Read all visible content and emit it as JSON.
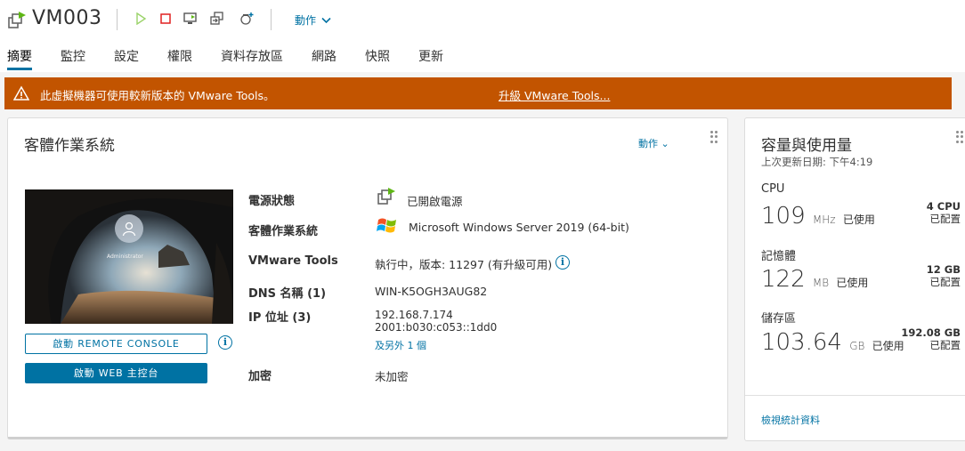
{
  "header": {
    "title": "VM003",
    "actions_label": "動作",
    "icons": [
      "vm-powered-on-icon",
      "power-on-icon",
      "power-off-icon",
      "launch-console-icon",
      "migrate-icon",
      "snapshot-icon"
    ]
  },
  "tabs": [
    "摘要",
    "監控",
    "設定",
    "權限",
    "資料存放區",
    "網路",
    "快照",
    "更新"
  ],
  "active_tab": "摘要",
  "banner": {
    "message": "此虛擬機器可使用較新版本的 VMware Tools。",
    "link": "升級 VMware Tools...",
    "color": "#c25400"
  },
  "guest": {
    "title": "客體作業系統",
    "actions_label": "動作",
    "console_user": "Administrator",
    "remote_console_button": "啟動 REMOTE CONSOLE",
    "web_console_button": "啟動 WEB 主控台",
    "properties": {
      "power_label": "電源狀態",
      "power_value": "已開啟電源",
      "os_label": "客體作業系統",
      "os_value": "Microsoft Windows Server 2019 (64-bit)",
      "tools_label": "VMware Tools",
      "tools_value": "執行中，版本: 11297 (有升級可用)",
      "dns_label": "DNS 名稱 (1)",
      "dns_value": "WIN-K5OGH3AUG82",
      "ip_label": "IP 位址 (3)",
      "ip_value_1": "192.168.7.174",
      "ip_value_2": "2001:b030:c053::1dd0",
      "ip_more": "及另外 1 個",
      "encryption_label": "加密",
      "encryption_value": "未加密"
    }
  },
  "capacity": {
    "title": "容量與使用量",
    "updated": "上次更新日期: 下午4:19",
    "cpu": {
      "label": "CPU",
      "value": "109",
      "unit": "MHz",
      "used": "已使用",
      "allocated": "4 CPU",
      "allocated_label": "已配置"
    },
    "memory": {
      "label": "記憶體",
      "value": "122",
      "unit": "MB",
      "used": "已使用",
      "allocated": "12 GB",
      "allocated_label": "已配置"
    },
    "storage": {
      "label": "儲存區",
      "value": "103.64",
      "unit": "GB",
      "used": "已使用",
      "allocated": "192.08 GB",
      "allocated_label": "已配置"
    },
    "stats_link": "檢視統計資料"
  },
  "colors": {
    "accent": "#0072a3",
    "banner": "#c25400",
    "power_on": "#5eb715"
  }
}
